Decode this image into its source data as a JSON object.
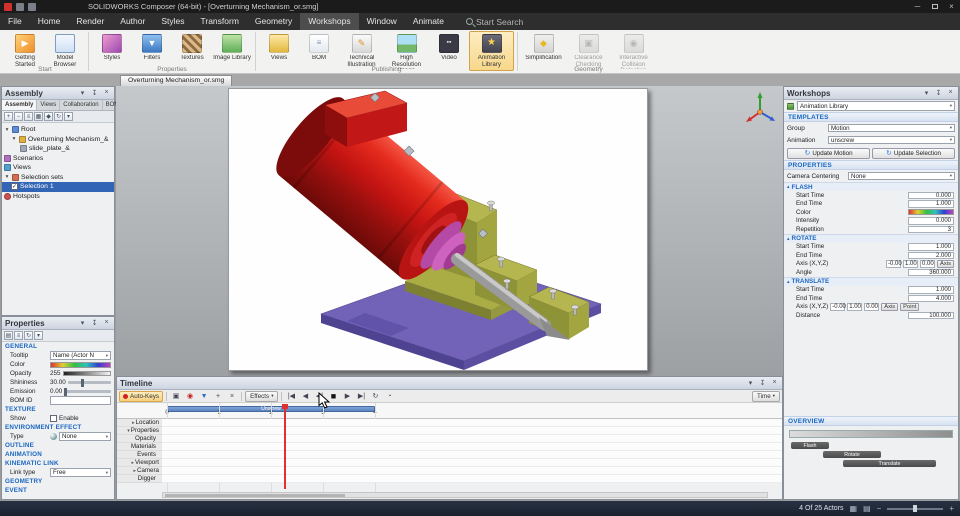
{
  "titlebar": {
    "title": "SOLIDWORKS Composer (64-bit) - [Overturning Mechanism_or.smg]"
  },
  "menubar": {
    "items": [
      "File",
      "Home",
      "Render",
      "Author",
      "Styles",
      "Transform",
      "Geometry",
      "Workshops",
      "Window",
      "Animate"
    ],
    "active_item": "Workshops",
    "search_label": "Start Search"
  },
  "ribbon": {
    "groups": [
      {
        "label": "Start",
        "items": [
          {
            "label": "Getting Started"
          },
          {
            "label": "Model Browser"
          }
        ]
      },
      {
        "label": "Properties",
        "items": [
          {
            "label": "Styles"
          },
          {
            "label": "Filters"
          },
          {
            "label": "Textures"
          },
          {
            "label": "Image Library"
          }
        ]
      },
      {
        "label": "Publishing",
        "items": [
          {
            "label": "Views"
          },
          {
            "label": "BOM"
          },
          {
            "label": "Technical Illustration"
          },
          {
            "label": "High Resolution Image"
          },
          {
            "label": "Video"
          },
          {
            "label": "Animation Library"
          }
        ]
      },
      {
        "label": "Geometry",
        "items": [
          {
            "label": "Simplification"
          },
          {
            "label": "Clearance Checking"
          },
          {
            "label": "Interactive Collision Detection"
          }
        ]
      }
    ],
    "active_item": "Animation Library"
  },
  "document": {
    "tab_label": "Overturning Mechanism_or.smg"
  },
  "assembly": {
    "title": "Assembly",
    "tabs": [
      "Assembly",
      "Views",
      "Collaboration",
      "BOM"
    ],
    "active_tab": "Assembly",
    "tree": [
      {
        "label": "Root"
      },
      {
        "label": "Overturning Mechanism_&"
      },
      {
        "label": "slide_plate_&"
      },
      {
        "label": "Scenarios"
      },
      {
        "label": "Views"
      },
      {
        "label": "Selection sets"
      },
      {
        "label": "Selection 1"
      },
      {
        "label": "Hotspots"
      }
    ],
    "selected_item": "Selection 1"
  },
  "properties": {
    "title": "Properties",
    "general_header": "GENERAL",
    "tooltip_label": "Tooltip",
    "tooltip_value": "Name (Actor N",
    "color_label": "Color",
    "opacity_label": "Opacity",
    "opacity_value": "255",
    "shininess_label": "Shininess",
    "shininess_value": "30.00",
    "emission_label": "Emission",
    "emission_value": "0.00",
    "bomid_label": "BOM ID",
    "texture_header": "TEXTURE",
    "show_label": "Show",
    "show_value": "Enable",
    "environment_header": "ENVIRONMENT EFFECT",
    "type_label": "Type",
    "type_value": "None",
    "outline_header": "OUTLINE",
    "animation_header": "ANIMATION",
    "kinematic_header": "KINEMATIC LINK",
    "linktype_label": "Link type",
    "linktype_value": "Free",
    "geometry_header": "GEOMETRY",
    "event_header": "EVENT"
  },
  "workshops": {
    "title": "Workshops",
    "library_selector": "Animation Library",
    "templates_header": "TEMPLATES",
    "group_label": "Group",
    "group_value": "Motion",
    "animation_label": "Animation",
    "animation_value": "unscrew",
    "update_motion": "Update Motion",
    "update_selection": "Update Selection",
    "properties_header": "PROPERTIES",
    "camera_centering_label": "Camera Centering",
    "camera_centering_value": "None",
    "flash": {
      "header": "FLASH",
      "start_label": "Start Time",
      "start_value": "0.000",
      "end_label": "End Time",
      "end_value": "1.000",
      "color_label": "Color",
      "intensity_label": "Intensity",
      "intensity_value": "0.000",
      "repetition_label": "Repetition",
      "repetition_value": "3"
    },
    "rotate": {
      "header": "ROTATE",
      "start_label": "Start Time",
      "start_value": "1.000",
      "end_label": "End Time",
      "end_value": "2.000",
      "axis_label": "Axis (X,Y,Z)",
      "axis_x": "-0.00",
      "axis_y": "1.00",
      "axis_z": "0.00",
      "axis_button": "Axis",
      "angle_label": "Angle",
      "angle_value": "360.000"
    },
    "translate": {
      "header": "TRANSLATE",
      "start_label": "Start Time",
      "start_value": "1.000",
      "end_label": "End Time",
      "end_value": "4.000",
      "axis_label": "Axis (X,Y,Z)",
      "axis_x": "-0.00",
      "axis_y": "1.00",
      "axis_z": "0.00",
      "axis_button": "Axis",
      "point_button": "Point",
      "distance_label": "Distance",
      "distance_value": "100.000"
    },
    "overview": {
      "header": "OVERVIEW",
      "bars": [
        {
          "label": "Flash"
        },
        {
          "label": "Rotate"
        },
        {
          "label": "Translate"
        }
      ]
    }
  },
  "timeline": {
    "title": "Timeline",
    "auto_keys": "Auto-Keys",
    "effects_label": "Effects",
    "time_label": "Time",
    "span_label": "Unscrew",
    "ticks": [
      "0",
      "1",
      "2",
      "3",
      "4"
    ],
    "tracks": [
      "Location",
      "Properties",
      "Opacity",
      "Materials",
      "Events",
      "Viewport",
      "Camera",
      "Digger"
    ]
  },
  "statusbar": {
    "actors_label": "4 Of 25 Actors"
  }
}
